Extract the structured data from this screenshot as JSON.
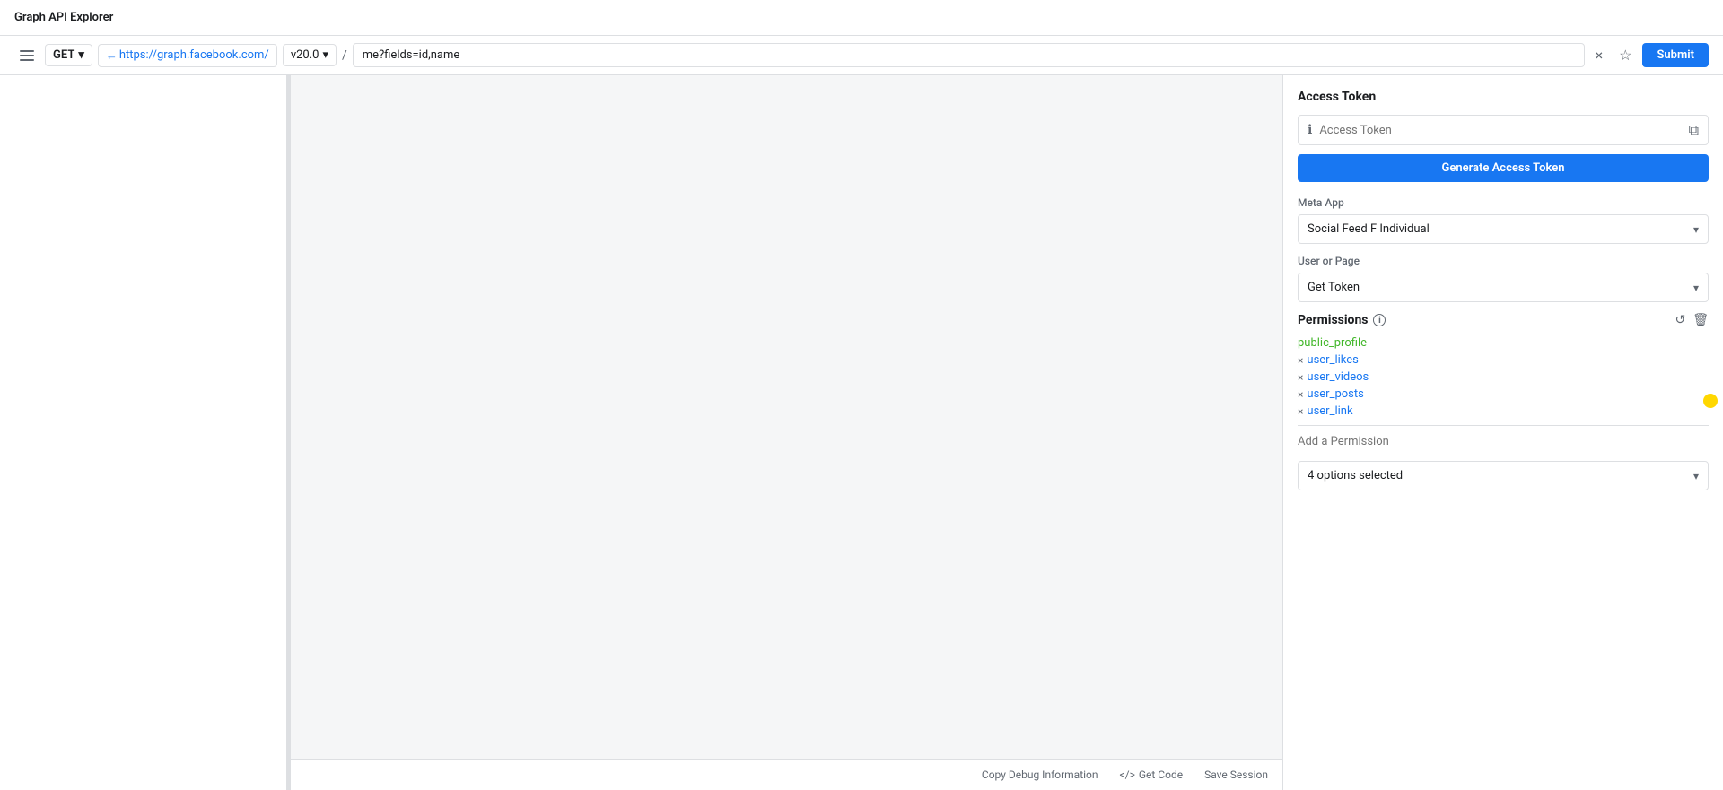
{
  "topBar": {
    "title": "Graph API Explorer"
  },
  "toolbar": {
    "hamburger": "menu",
    "method": "GET",
    "baseUrl": "https://graph.facebook.com/",
    "version": "v20.0",
    "pathSeparator": "/",
    "query": "me?fields=id,name",
    "clearLabel": "×",
    "starLabel": "☆",
    "submitLabel": "Submit"
  },
  "rightPanel": {
    "accessToken": {
      "title": "Access Token",
      "placeholder": "Access Token",
      "generateButtonLabel": "Generate Access Token"
    },
    "metaApp": {
      "label": "Meta App",
      "selected": "Social Feed F Individual",
      "options": [
        "Social Feed F Individual"
      ]
    },
    "userOrPage": {
      "label": "User or Page",
      "selected": "Get Token",
      "options": [
        "Get Token"
      ]
    },
    "permissions": {
      "title": "Permissions",
      "items": [
        {
          "name": "public_profile",
          "removable": false,
          "color": "green"
        },
        {
          "name": "user_likes",
          "removable": true,
          "color": "blue"
        },
        {
          "name": "user_videos",
          "removable": true,
          "color": "blue"
        },
        {
          "name": "user_posts",
          "removable": true,
          "color": "blue"
        },
        {
          "name": "user_link",
          "removable": true,
          "color": "blue"
        }
      ],
      "addPlaceholder": "Add a Permission",
      "optionsSelected": "4 options selected"
    }
  },
  "centerFooter": {
    "copyDebug": "Copy Debug Information",
    "getCode": "Get Code",
    "saveSession": "Save Session"
  }
}
